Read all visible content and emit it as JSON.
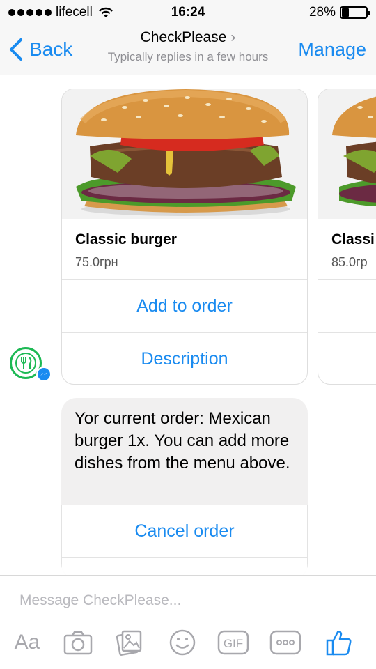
{
  "status_bar": {
    "carrier": "lifecell",
    "time": "16:24",
    "battery": "28%",
    "battery_level": 0.28
  },
  "nav": {
    "back_label": "Back",
    "title": "CheckPlease",
    "subtitle": "Typically replies in a few hours",
    "manage_label": "Manage"
  },
  "cards": [
    {
      "title": "Classic burger",
      "price": "75.0грн",
      "buttons": [
        "Add to order",
        "Description"
      ]
    },
    {
      "title": "Classi",
      "price": "85.0гр"
    }
  ],
  "order_message": {
    "text": "Yor current order: Mexican burger 1x. You can add more dishes from the menu above.",
    "button": "Cancel order"
  },
  "composer": {
    "placeholder": "Message CheckPlease...",
    "aa_label": "Aa",
    "gif_label": "GIF"
  },
  "colors": {
    "accent": "#1a8bf0",
    "bot_green": "#1db954",
    "bubble_gray": "#f1f0f0"
  },
  "icons": [
    "back-chevron-icon",
    "wifi-icon",
    "battery-icon",
    "camera-icon",
    "photo-icon",
    "emoji-icon",
    "gif-icon",
    "more-icon",
    "thumbs-up-icon",
    "fork-knife-icon",
    "messenger-icon"
  ]
}
